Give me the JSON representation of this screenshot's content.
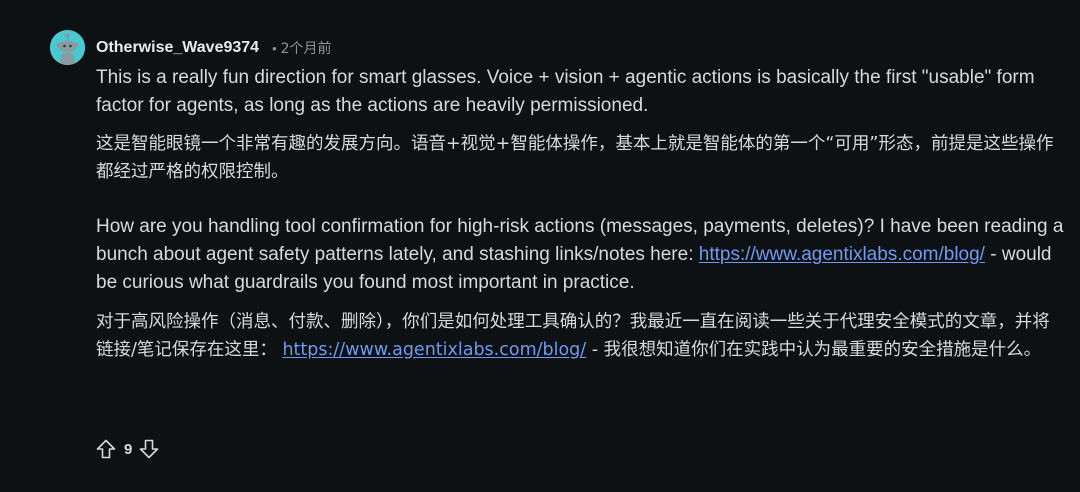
{
  "comment": {
    "username": "Otherwise_Wave9374",
    "separator": "•",
    "timestamp": "2个月前",
    "avatar_color": "#4ac8cf",
    "link_color": "#6e9bf0",
    "para1_en": "This is a really fun direction for smart glasses. Voice + vision + agentic actions is basically the first \"usable\" form factor for agents, as long as the actions are heavily permissioned.",
    "para1_zh": "这是智能眼镜一个非常有趣的发展方向。语音+视觉+智能体操作，基本上就是智能体的第一个“可用”形态，前提是这些操作都经过严格的权限控制。",
    "para2_en_before": "How are you handling tool confirmation for high-risk actions (messages, payments, deletes)? I have been reading a bunch about agent safety patterns lately, and stashing links/notes here: ",
    "para2_en_link": "https://www.agentixlabs.com/blog/",
    "para2_en_after": " - would be curious what guardrails you found most important in practice.",
    "para2_zh_before": "对于高风险操作（消息、付款、删除），你们是如何处理工具确认的？我最近一直在阅读一些关于代理安全模式的文章，并将链接/笔记保存在这里： ",
    "para2_zh_link": "https://www.agentixlabs.com/blog/",
    "para2_zh_after": " - 我很想知道你们在实践中认为最重要的安全措施是什么。",
    "vote_score": "9",
    "upvote_icon": "arrow-up-icon",
    "downvote_icon": "arrow-down-icon"
  }
}
